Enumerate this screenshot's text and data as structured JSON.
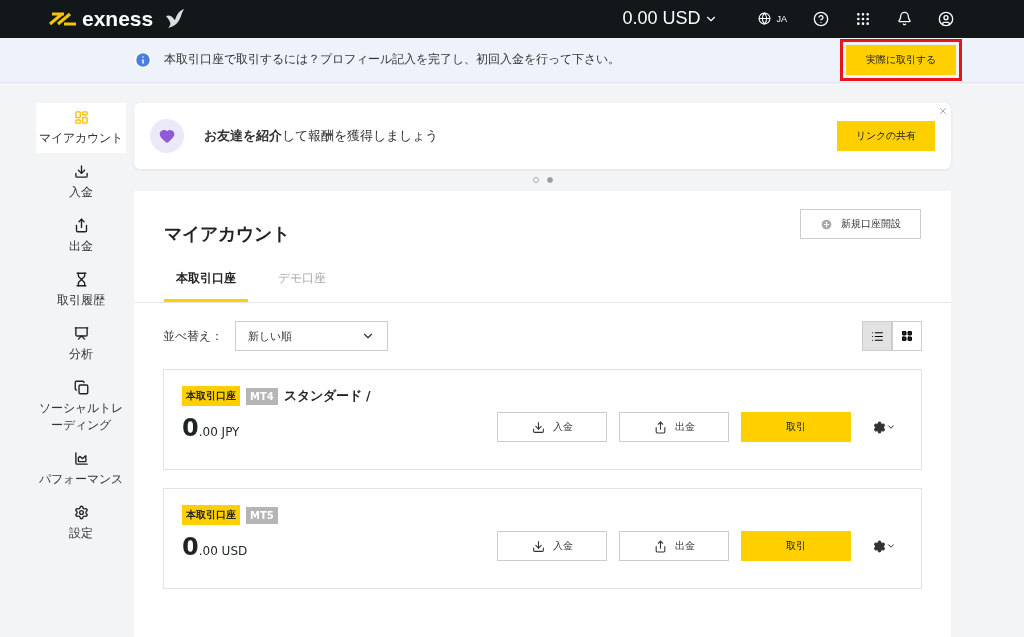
{
  "header": {
    "logo": "exness",
    "balance": "0.00 USD",
    "language": "JA"
  },
  "notice": {
    "text": "本取引口座で取引するには？プロフィール記入を完了し、初回入金を行って下さい。",
    "button": "実際に取引する",
    "highlighted": true
  },
  "sidebar": {
    "items": [
      {
        "label": "マイアカウント",
        "selected": true
      },
      {
        "label": "入金",
        "selected": false
      },
      {
        "label": "出金",
        "selected": false
      },
      {
        "label": "取引履歴",
        "selected": false
      },
      {
        "label": "分析",
        "selected": false
      },
      {
        "label": "ソーシャルトレーディング",
        "selected": false
      },
      {
        "label": "パフォーマンス",
        "selected": false
      },
      {
        "label": "設定",
        "selected": false
      }
    ]
  },
  "promo": {
    "text": "**お友達を紹介**して報酬を獲得しましょう",
    "button": "リンクの共有",
    "dots": [
      {
        "selected": false
      },
      {
        "selected": true
      }
    ]
  },
  "accounts_panel": {
    "title": "マイアカウント",
    "new_account_button": "新規口座開設",
    "tabs": [
      {
        "label": "本取引口座",
        "selected": true
      },
      {
        "label": "デモ口座",
        "selected": false
      }
    ],
    "sort": {
      "label": "並べ替え：",
      "value": "新しい順"
    },
    "view": [
      {
        "kind": "list",
        "selected": true
      },
      {
        "kind": "grid",
        "selected": false
      }
    ],
    "accounts": [
      {
        "type_badge": "本取引口座",
        "platform": "MT4",
        "name": "スタンダード /",
        "integer": "0",
        "rest": ".00 JPY",
        "deposit": "入金",
        "withdraw": "出金",
        "trade": "取引"
      },
      {
        "type_badge": "本取引口座",
        "platform": "MT5",
        "integer": "0",
        "rest": ".00 USD",
        "deposit": "入金",
        "withdraw": "出金",
        "trade": "取引"
      }
    ]
  }
}
